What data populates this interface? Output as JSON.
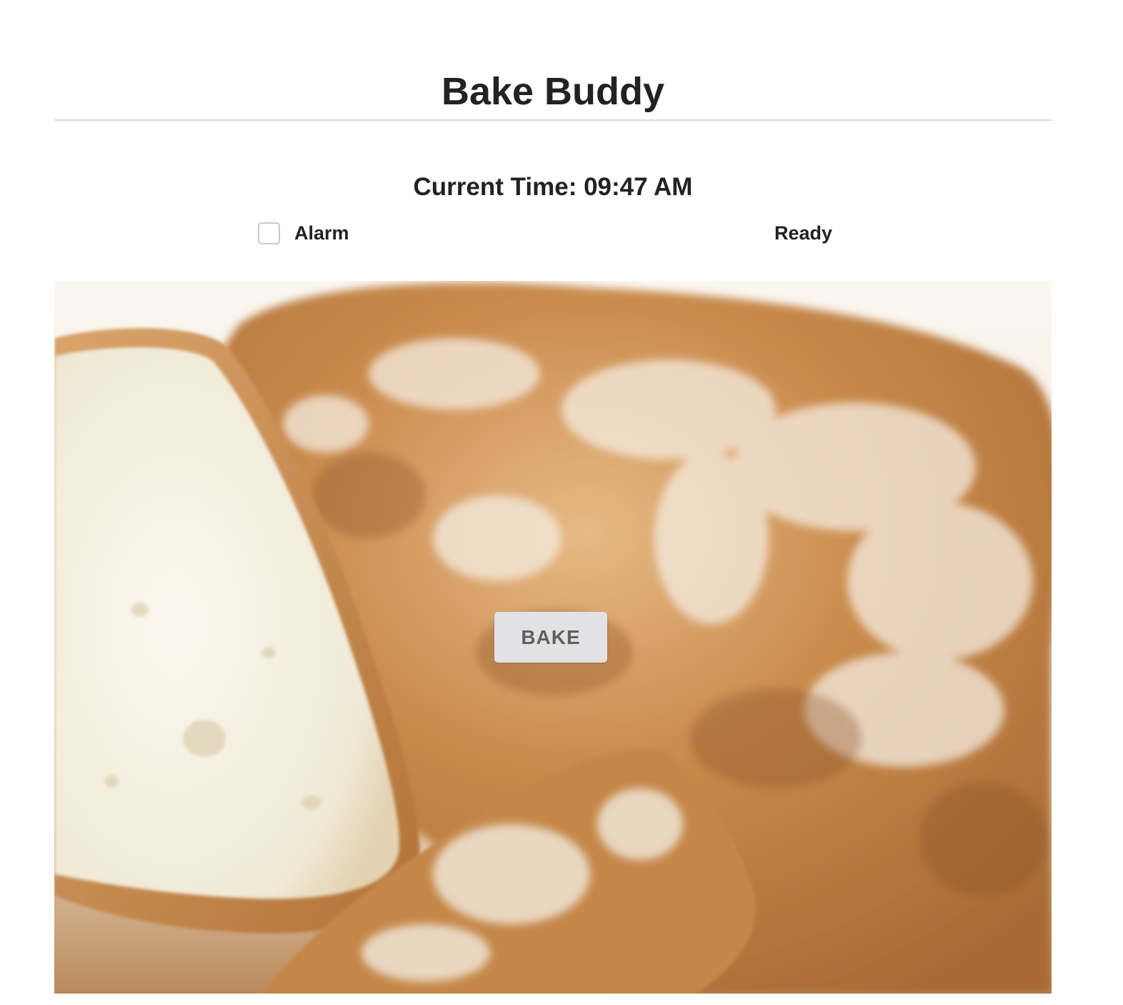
{
  "header": {
    "title": "Bake Buddy"
  },
  "clock": {
    "text": "Current Time: 09:47 AM"
  },
  "alarm": {
    "label": "Alarm",
    "checked": false
  },
  "status": {
    "text": "Ready"
  },
  "bake_button": {
    "label": "BAKE"
  },
  "photo": {
    "subject": "bread-loaf-photo"
  },
  "colors": {
    "divider": "#dcdcdc",
    "button_bg": "#e2e2e4",
    "button_text": "#606060",
    "text": "#222222"
  }
}
